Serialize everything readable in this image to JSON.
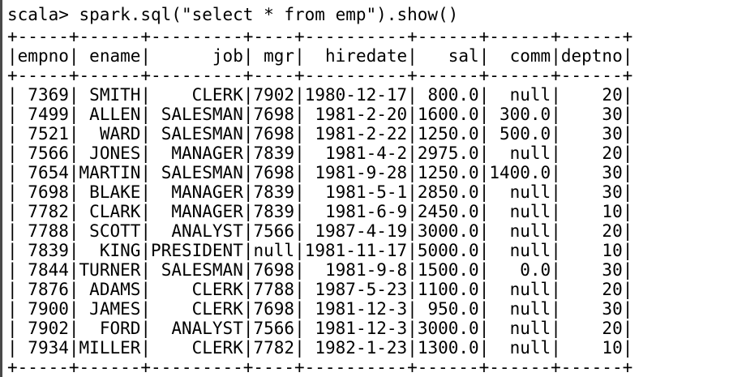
{
  "terminal": {
    "prompt": "scala>",
    "command": "spark.sql(\"select * from emp\").show()"
  },
  "table": {
    "border": "+-----+------+---------+----+----------+------+------+------+",
    "columns": [
      "empno",
      "ename",
      "job",
      "mgr",
      "hiredate",
      "sal",
      "comm",
      "deptno"
    ],
    "rows": [
      [
        "7369",
        "SMITH",
        "CLERK",
        "7902",
        "1980-12-17",
        "800.0",
        "null",
        "20"
      ],
      [
        "7499",
        "ALLEN",
        "SALESMAN",
        "7698",
        "1981-2-20",
        "1600.0",
        "300.0",
        "30"
      ],
      [
        "7521",
        "WARD",
        "SALESMAN",
        "7698",
        "1981-2-22",
        "1250.0",
        "500.0",
        "30"
      ],
      [
        "7566",
        "JONES",
        "MANAGER",
        "7839",
        "1981-4-2",
        "2975.0",
        "null",
        "20"
      ],
      [
        "7654",
        "MARTIN",
        "SALESMAN",
        "7698",
        "1981-9-28",
        "1250.0",
        "1400.0",
        "30"
      ],
      [
        "7698",
        "BLAKE",
        "MANAGER",
        "7839",
        "1981-5-1",
        "2850.0",
        "null",
        "30"
      ],
      [
        "7782",
        "CLARK",
        "MANAGER",
        "7839",
        "1981-6-9",
        "2450.0",
        "null",
        "10"
      ],
      [
        "7788",
        "SCOTT",
        "ANALYST",
        "7566",
        "1987-4-19",
        "3000.0",
        "null",
        "20"
      ],
      [
        "7839",
        "KING",
        "PRESIDENT",
        "null",
        "1981-11-17",
        "5000.0",
        "null",
        "10"
      ],
      [
        "7844",
        "TURNER",
        "SALESMAN",
        "7698",
        "1981-9-8",
        "1500.0",
        "0.0",
        "30"
      ],
      [
        "7876",
        "ADAMS",
        "CLERK",
        "7788",
        "1987-5-23",
        "1100.0",
        "null",
        "20"
      ],
      [
        "7900",
        "JAMES",
        "CLERK",
        "7698",
        "1981-12-3",
        "950.0",
        "null",
        "30"
      ],
      [
        "7902",
        "FORD",
        "ANALYST",
        "7566",
        "1981-12-3",
        "3000.0",
        "null",
        "20"
      ],
      [
        "7934",
        "MILLER",
        "CLERK",
        "7782",
        "1982-1-23",
        "1300.0",
        "null",
        "10"
      ]
    ]
  }
}
